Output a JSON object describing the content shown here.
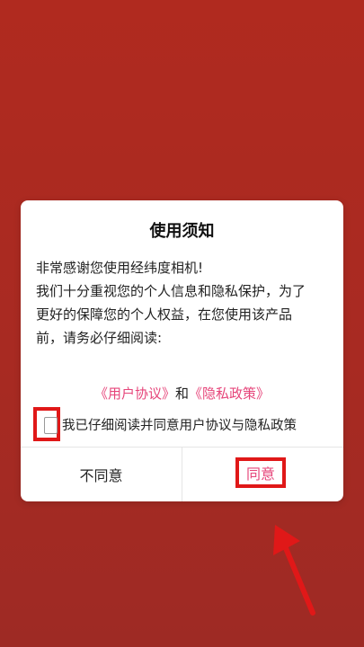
{
  "dialog": {
    "title": "使用须知",
    "greeting": "非常感谢您使用经纬度相机!",
    "paragraph_line1": "我们十分重视您的个人信息和隐私保护，为了",
    "paragraph_line2": "更好的保障您的个人权益，在您使用该产品",
    "paragraph_line3": "前，请务必仔细阅读:",
    "user_agreement_link": "《用户协议》",
    "and_text": "和",
    "privacy_policy_link": "《隐私政策》",
    "agree_checkbox_label": "我已仔细阅读并同意用户协议与隐私政策",
    "agree_checkbox_checked": false,
    "disagree_button": "不同意",
    "agree_button": "同意"
  },
  "colors": {
    "background": "#a82a22",
    "link": "#e6457a",
    "highlight": "#e01818"
  },
  "icons": {
    "annotation_arrow": "arrow-up-left-icon"
  }
}
